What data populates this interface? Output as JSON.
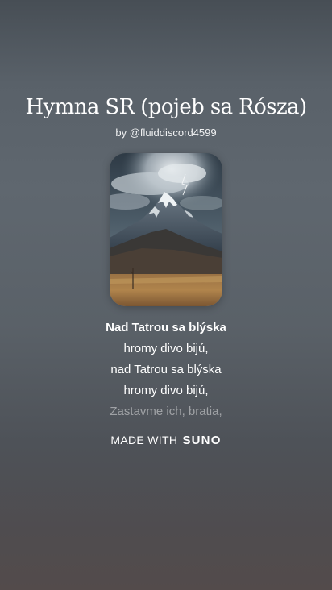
{
  "song": {
    "title": "Hymna SR (pojeb sa Rósza)",
    "byline": "by @fluiddiscord4599"
  },
  "cover": {
    "icon": "mountain-landscape-image"
  },
  "lyrics": {
    "lines": [
      "Nad Tatrou sa blýska",
      "hromy divo bijú,",
      "nad Tatrou sa blýska",
      "hromy divo bijú,",
      "Zastavme ich, bratia,"
    ]
  },
  "footer": {
    "made_with": "MADE WITH",
    "brand": "SUNO"
  },
  "colors": {
    "background_top": "#474e55",
    "background_bottom": "#534b4b",
    "text": "#ffffff"
  }
}
